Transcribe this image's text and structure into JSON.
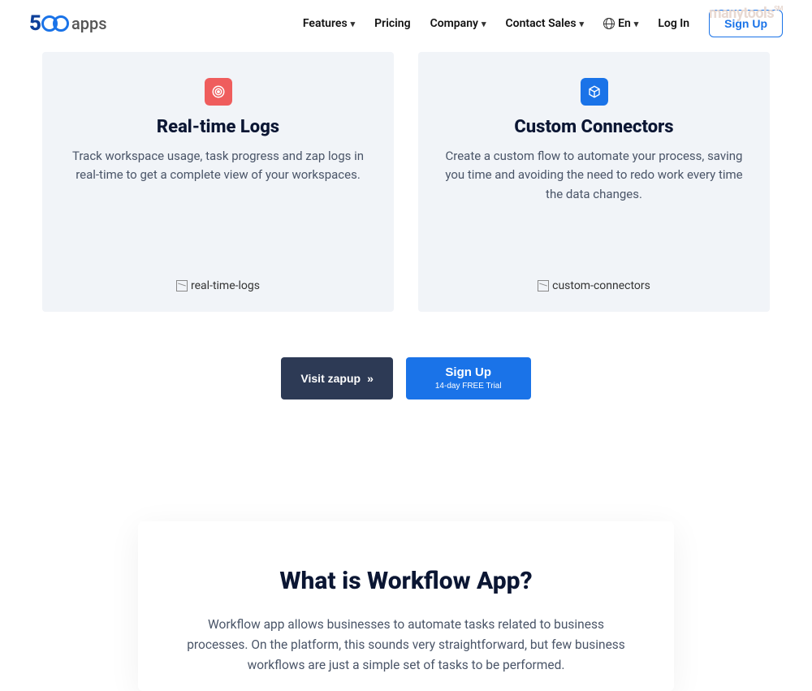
{
  "header": {
    "logo_prefix": "5",
    "logo_suffix": "apps",
    "nav": {
      "features": "Features",
      "pricing": "Pricing",
      "company": "Company",
      "contact": "Contact Sales",
      "lang": "En",
      "login": "Log In",
      "signup": "Sign Up"
    },
    "watermark": "manytools",
    "watermark_sup": "SM"
  },
  "cards": {
    "left": {
      "title": "Real-time Logs",
      "desc": "Track workspace usage, task progress and zap logs in real-time to get a complete view of your workspaces.",
      "img_alt": "real-time-logs"
    },
    "right": {
      "title": "Custom Connectors",
      "desc": "Create a custom flow to automate your process, saving you time and avoiding the need to redo work every time the data changes.",
      "img_alt": "custom-connectors"
    }
  },
  "cta": {
    "visit": "Visit zapup",
    "signup": "Sign Up",
    "signup_sub": "14-day FREE Trial"
  },
  "section2": {
    "title": "What is Workflow App?",
    "desc": "Workflow app allows businesses to automate tasks related to business processes. On the platform, this sounds very straightforward, but few business workflows are just a simple set of tasks to be performed."
  }
}
